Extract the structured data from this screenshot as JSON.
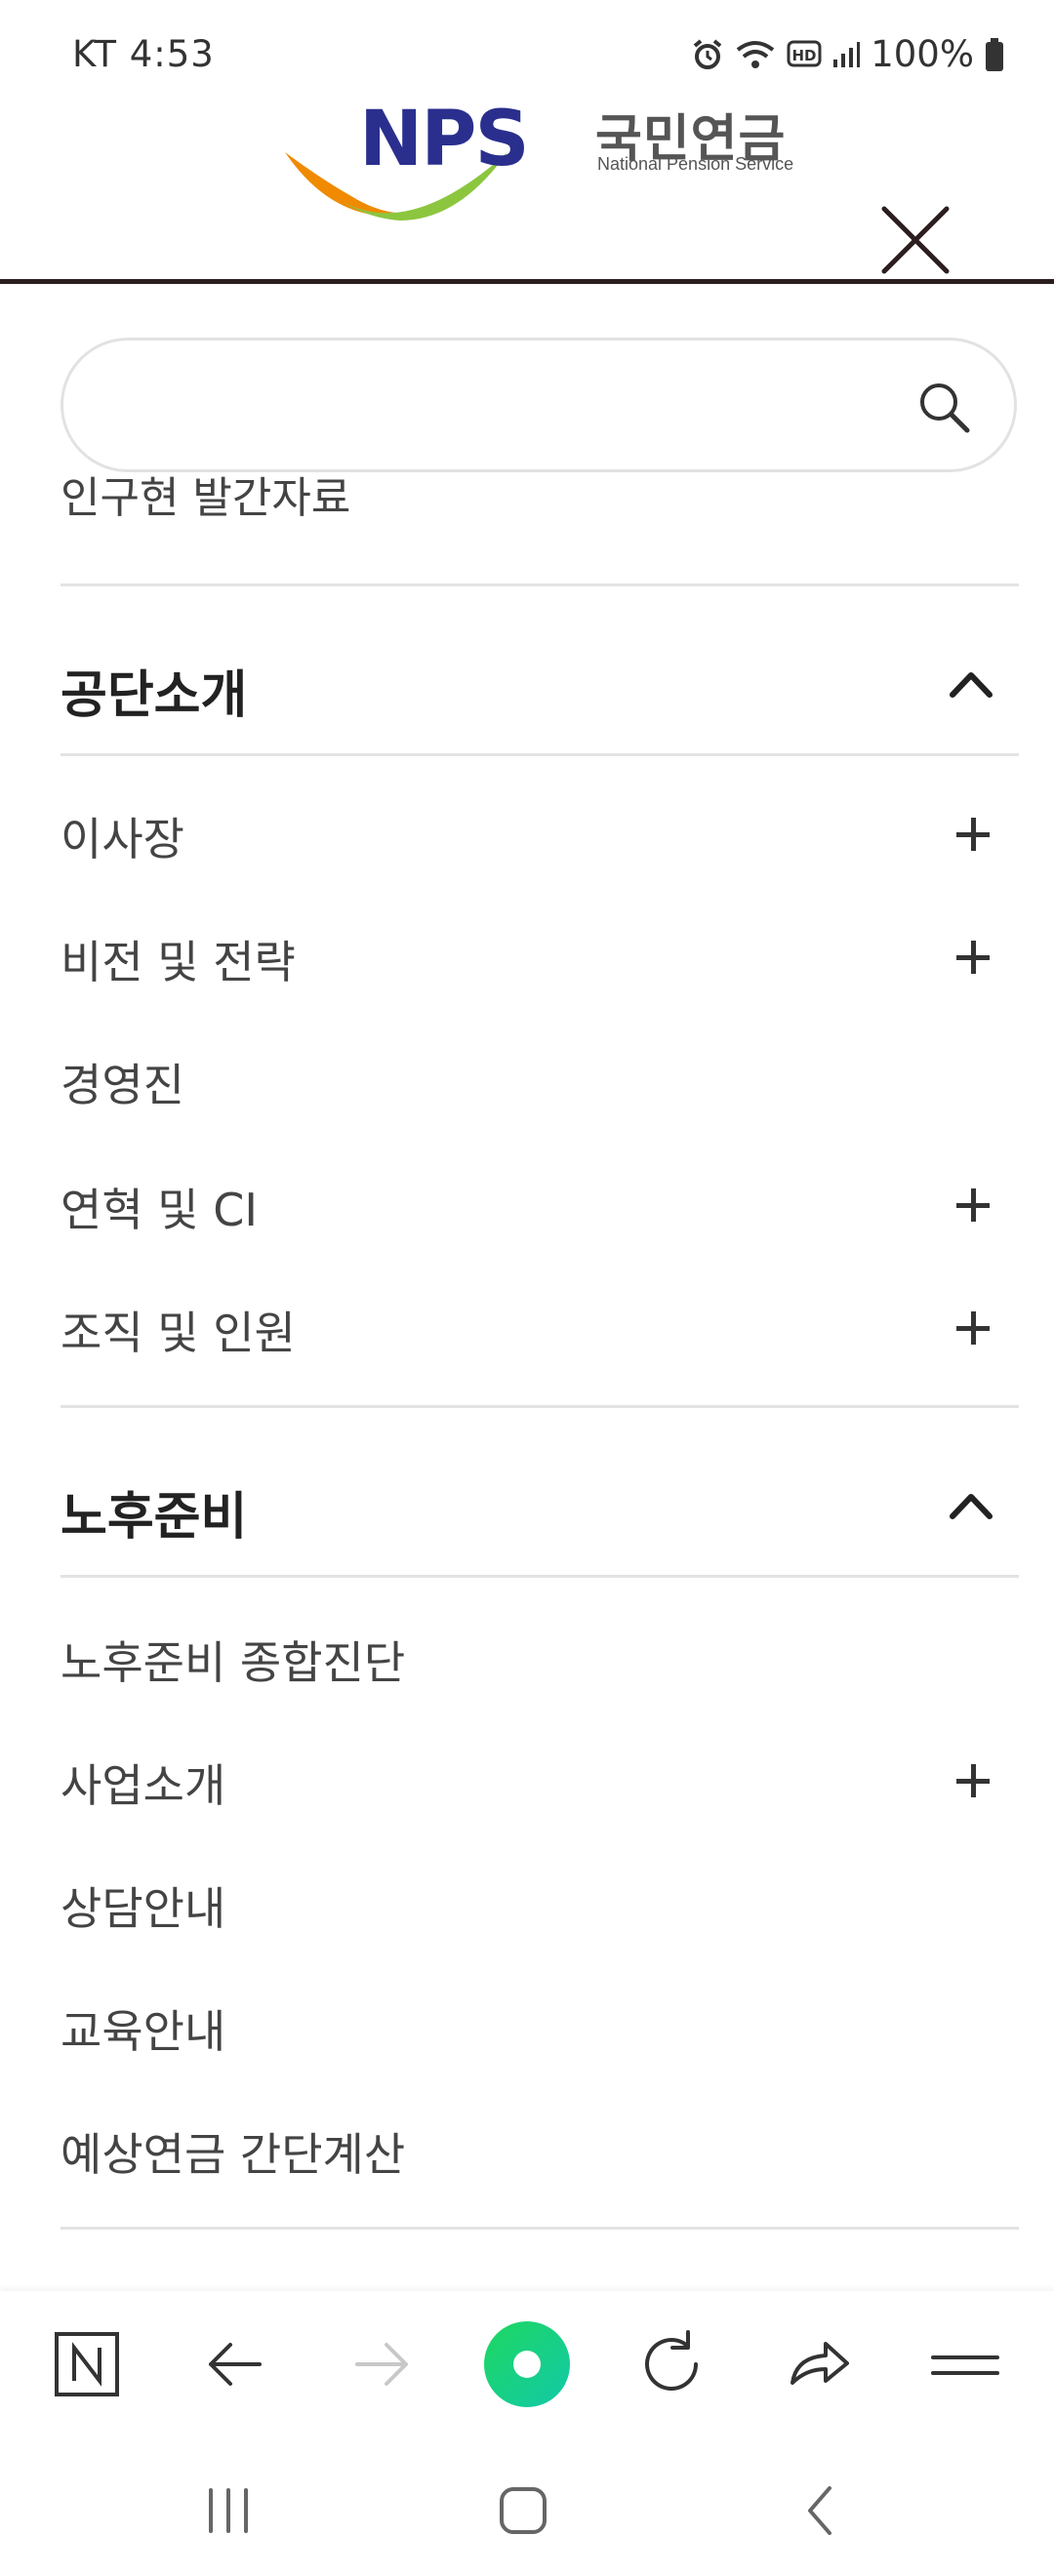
{
  "status_bar": {
    "carrier_time": "KT 4:53",
    "battery": "100%",
    "icons": [
      "alarm-icon",
      "wifi-icon",
      "hd-icon",
      "signal-icon",
      "battery-icon"
    ]
  },
  "header": {
    "logo_letters": "NPS",
    "logo_korean": "국민연금",
    "logo_english": "National Pension Service",
    "close_icon": "close-icon"
  },
  "search": {
    "value": "",
    "placeholder": ""
  },
  "menu": {
    "clipped_item": "인구현 발간자료",
    "sections": [
      {
        "title": "공단소개",
        "expanded": true,
        "items": [
          {
            "label": "이사장",
            "expandable": true
          },
          {
            "label": "비전 및 전략",
            "expandable": true
          },
          {
            "label": "경영진",
            "expandable": false
          },
          {
            "label": "연혁 및 CI",
            "expandable": true
          },
          {
            "label": "조직 및 인원",
            "expandable": true
          }
        ]
      },
      {
        "title": "노후준비",
        "expanded": true,
        "items": [
          {
            "label": "노후준비 종합진단",
            "expandable": false
          },
          {
            "label": "사업소개",
            "expandable": true
          },
          {
            "label": "상담안내",
            "expandable": false
          },
          {
            "label": "교육안내",
            "expandable": false
          },
          {
            "label": "예상연금 간단계산",
            "expandable": false
          }
        ]
      }
    ]
  },
  "toolbar": {
    "buttons": [
      "naver-home-icon",
      "back-arrow-icon",
      "forward-arrow-icon",
      "green-dot-icon",
      "refresh-icon",
      "share-icon",
      "menu-icon"
    ],
    "accent": "#1fd08a"
  },
  "navbar": {
    "buttons": [
      "recent-apps-icon",
      "home-icon",
      "back-icon"
    ]
  }
}
